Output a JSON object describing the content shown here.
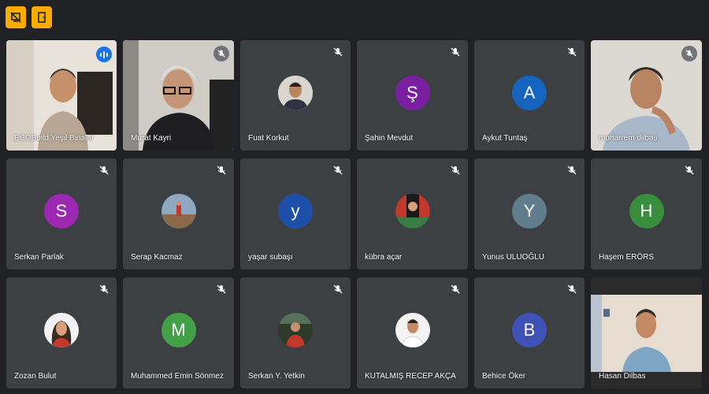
{
  "toolbar": {
    "icons": [
      "presentation-off-icon",
      "exit-door-icon"
    ],
    "accent_color": "#f9ab00"
  },
  "participants": [
    {
      "name": "ECOBuild Yeşil Binalar",
      "type": "video",
      "speaking": true
    },
    {
      "name": "Murat Kayri",
      "type": "video",
      "muted": true
    },
    {
      "name": "Fuat Korkut",
      "type": "photo",
      "muted": true
    },
    {
      "name": "Şahin Mevdut",
      "type": "initial",
      "initial": "Ş",
      "color": "#7b1fa2",
      "muted": true
    },
    {
      "name": "Aykut Tuntaş",
      "type": "initial",
      "initial": "A",
      "color": "#1565c0",
      "muted": true
    },
    {
      "name": "muharrem dilbas",
      "type": "video",
      "muted": true
    },
    {
      "name": "Serkan Parlak",
      "type": "initial",
      "initial": "S",
      "color": "#9c27b0",
      "muted": true
    },
    {
      "name": "Serap Kacmaz",
      "type": "photo",
      "muted": true
    },
    {
      "name": "yaşar subaşı",
      "type": "initial",
      "initial": "y",
      "color": "#1e4fa8",
      "muted": true
    },
    {
      "name": "kübra açar",
      "type": "photo",
      "muted": true
    },
    {
      "name": "Yunus ULUOĞLU",
      "type": "initial",
      "initial": "Y",
      "color": "#607d8b",
      "muted": true
    },
    {
      "name": "Haşem ERÖRS",
      "type": "initial",
      "initial": "H",
      "color": "#388e3c",
      "muted": true
    },
    {
      "name": "Zozan Bulut",
      "type": "photo",
      "muted": true
    },
    {
      "name": "Muhammed Emin Sönmez",
      "type": "initial",
      "initial": "M",
      "color": "#43a047",
      "muted": true
    },
    {
      "name": "Serkan Y. Yetkin",
      "type": "photo",
      "muted": true
    },
    {
      "name": "KUTALMIŞ RECEP AKÇA",
      "type": "photo",
      "muted": true
    },
    {
      "name": "Behice Öker",
      "type": "initial",
      "initial": "B",
      "color": "#3f51b5",
      "muted": true
    },
    {
      "name": "Hasan Dilbas",
      "type": "video",
      "muted": false
    }
  ]
}
